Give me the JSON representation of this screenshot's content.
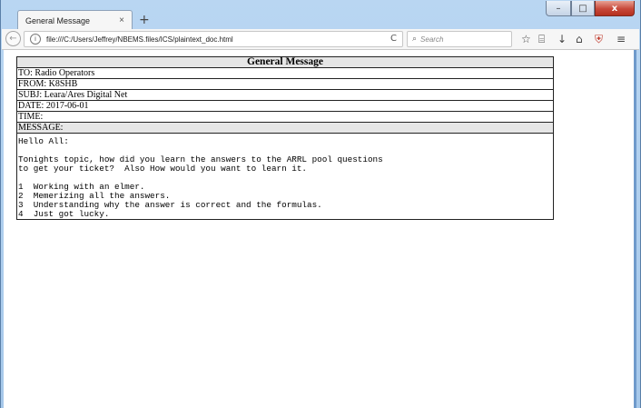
{
  "browser": {
    "tab_title": "General Message",
    "tab_close": "×",
    "new_tab": "+",
    "url": "file:///C:/Users/Jeffrey/NBEMS.files/ICS/plaintext_doc.html",
    "search_placeholder": "Search",
    "reload_glyph": "C",
    "toolbar_icons": [
      "star-icon",
      "clipboard-icon",
      "download-icon",
      "home-icon",
      "shield-icon",
      "menu-icon"
    ]
  },
  "window_controls": {
    "minimize": "–",
    "maximize": "□",
    "close": "x"
  },
  "message": {
    "title": "General Message",
    "to": "TO: Radio Operators",
    "from": "FROM: K8SHB",
    "subj": "SUBJ: Leara/Ares Digital Net",
    "date": "DATE: 2017-06-01",
    "time": "TIME:",
    "message_label": "MESSAGE:",
    "body": "Hello All:\n\nTonights topic, how did you learn the answers to the ARRL pool questions\nto get your ticket?  Also How would you want to learn it.\n\n1  Working with an elmer.\n2  Memerizing all the answers.\n3  Understanding why the answer is correct and the formulas.\n4  Just got lucky."
  },
  "colors": {
    "window_frame": "#a6c8ea",
    "close_button": "#c7483a",
    "header_cell_bg": "#e6e6e6"
  }
}
